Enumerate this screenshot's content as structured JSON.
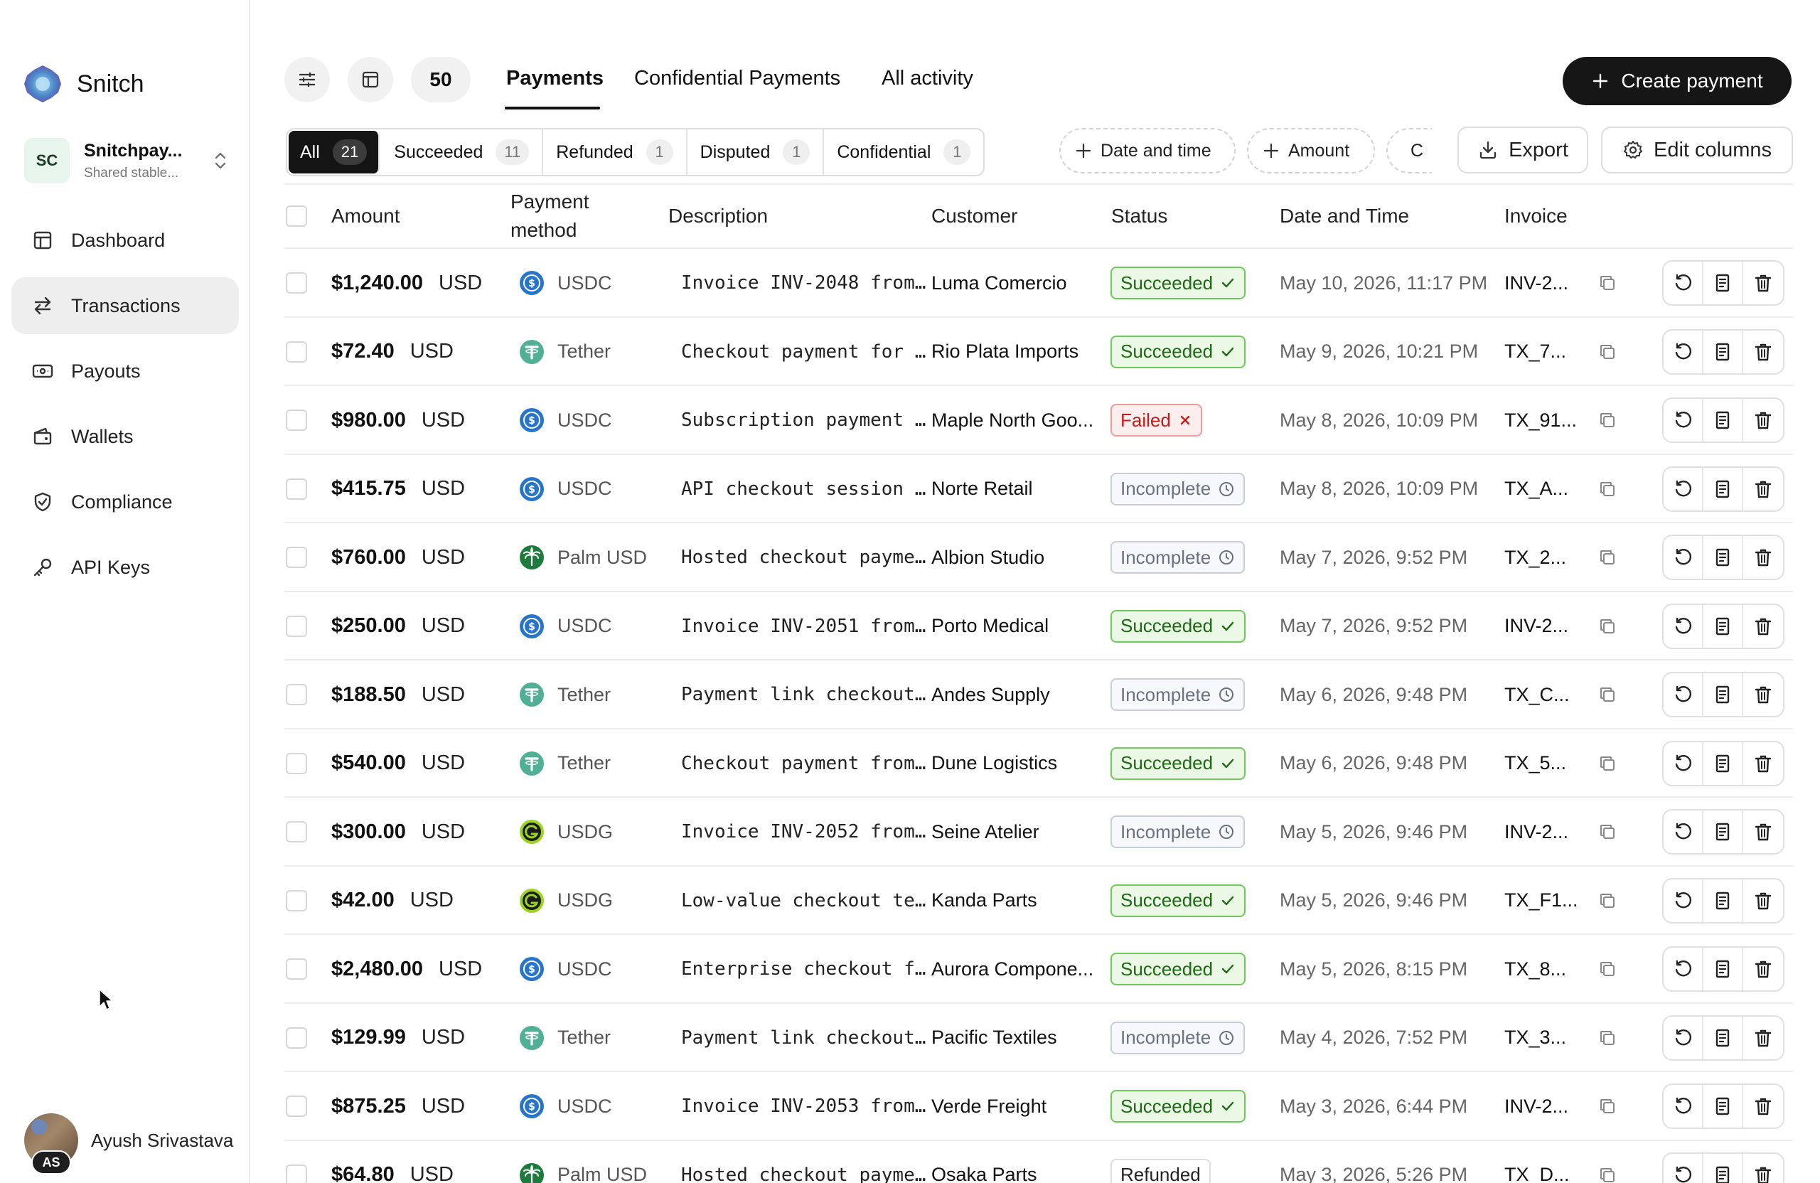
{
  "brand": {
    "name": "Snitch"
  },
  "org": {
    "initials": "SC",
    "name": "Snitchpay...",
    "subtitle": "Shared stable..."
  },
  "nav": [
    {
      "label": "Dashboard",
      "icon": "dashboard-icon",
      "active": false
    },
    {
      "label": "Transactions",
      "icon": "arrows-exchange-icon",
      "active": true
    },
    {
      "label": "Payouts",
      "icon": "banknote-icon",
      "active": false
    },
    {
      "label": "Wallets",
      "icon": "wallet-icon",
      "active": false
    },
    {
      "label": "Compliance",
      "icon": "shield-check-icon",
      "active": false
    },
    {
      "label": "API Keys",
      "icon": "key-icon",
      "active": false
    }
  ],
  "user": {
    "name": "Ayush Srivastava",
    "initials": "AS"
  },
  "toolbar": {
    "page_size": "50",
    "tabs": [
      "Payments",
      "Confidential Payments",
      "All activity"
    ],
    "active_tab": "Payments",
    "create_label": "Create payment"
  },
  "filters": {
    "segments": [
      {
        "label": "All",
        "count": "21",
        "active": true
      },
      {
        "label": "Succeeded",
        "count": "11",
        "active": false
      },
      {
        "label": "Refunded",
        "count": "1",
        "active": false
      },
      {
        "label": "Disputed",
        "count": "1",
        "active": false
      },
      {
        "label": "Confidential",
        "count": "1",
        "active": false
      }
    ],
    "add_chips": [
      "Date and time",
      "Amount",
      "C"
    ],
    "export_label": "Export",
    "edit_columns_label": "Edit columns"
  },
  "table": {
    "headers": {
      "amount": "Amount",
      "payment_method": "Payment method",
      "description": "Description",
      "customer": "Customer",
      "status": "Status",
      "date": "Date and Time",
      "invoice": "Invoice"
    },
    "rows": [
      {
        "amount": "$1,240.00",
        "currency": "USD",
        "method": "USDC",
        "description": "Invoice INV-2048 from…",
        "customer": "Luma Comercio",
        "status": "Succeeded",
        "date": "May 10, 2026, 11:17 PM",
        "invoice": "INV-2..."
      },
      {
        "amount": "$72.40",
        "currency": "USD",
        "method": "Tether",
        "description": "Checkout payment for …",
        "customer": "Rio Plata Imports",
        "status": "Succeeded",
        "date": "May 9, 2026, 10:21 PM",
        "invoice": "TX_7..."
      },
      {
        "amount": "$980.00",
        "currency": "USD",
        "method": "USDC",
        "description": "Subscription payment …",
        "customer": "Maple North Goo...",
        "status": "Failed",
        "date": "May 8, 2026, 10:09 PM",
        "invoice": "TX_91..."
      },
      {
        "amount": "$415.75",
        "currency": "USD",
        "method": "USDC",
        "description": "API checkout session …",
        "customer": "Norte Retail",
        "status": "Incomplete",
        "date": "May 8, 2026, 10:09 PM",
        "invoice": "TX_A..."
      },
      {
        "amount": "$760.00",
        "currency": "USD",
        "method": "Palm USD",
        "description": "Hosted checkout payme…",
        "customer": "Albion Studio",
        "status": "Incomplete",
        "date": "May 7, 2026, 9:52 PM",
        "invoice": "TX_2..."
      },
      {
        "amount": "$250.00",
        "currency": "USD",
        "method": "USDC",
        "description": "Invoice INV-2051 from…",
        "customer": "Porto Medical",
        "status": "Succeeded",
        "date": "May 7, 2026, 9:52 PM",
        "invoice": "INV-2..."
      },
      {
        "amount": "$188.50",
        "currency": "USD",
        "method": "Tether",
        "description": "Payment link checkout…",
        "customer": "Andes Supply",
        "status": "Incomplete",
        "date": "May 6, 2026, 9:48 PM",
        "invoice": "TX_C..."
      },
      {
        "amount": "$540.00",
        "currency": "USD",
        "method": "Tether",
        "description": "Checkout payment from…",
        "customer": "Dune Logistics",
        "status": "Succeeded",
        "date": "May 6, 2026, 9:48 PM",
        "invoice": "TX_5..."
      },
      {
        "amount": "$300.00",
        "currency": "USD",
        "method": "USDG",
        "description": "Invoice INV-2052 from…",
        "customer": "Seine Atelier",
        "status": "Incomplete",
        "date": "May 5, 2026, 9:46 PM",
        "invoice": "INV-2..."
      },
      {
        "amount": "$42.00",
        "currency": "USD",
        "method": "USDG",
        "description": "Low-value checkout te…",
        "customer": "Kanda Parts",
        "status": "Succeeded",
        "date": "May 5, 2026, 9:46 PM",
        "invoice": "TX_F1..."
      },
      {
        "amount": "$2,480.00",
        "currency": "USD",
        "method": "USDC",
        "description": "Enterprise checkout f…",
        "customer": "Aurora Compone...",
        "status": "Succeeded",
        "date": "May 5, 2026, 8:15 PM",
        "invoice": "TX_8..."
      },
      {
        "amount": "$129.99",
        "currency": "USD",
        "method": "Tether",
        "description": "Payment link checkout…",
        "customer": "Pacific Textiles",
        "status": "Incomplete",
        "date": "May 4, 2026, 7:52 PM",
        "invoice": "TX_3..."
      },
      {
        "amount": "$875.25",
        "currency": "USD",
        "method": "USDC",
        "description": "Invoice INV-2053 from…",
        "customer": "Verde Freight",
        "status": "Succeeded",
        "date": "May 3, 2026, 6:44 PM",
        "invoice": "INV-2..."
      },
      {
        "amount": "$64.80",
        "currency": "USD",
        "method": "Palm USD",
        "description": "Hosted checkout payme…",
        "customer": "Osaka Parts",
        "status": "Refunded",
        "date": "May 3, 2026, 5:26 PM",
        "invoice": "TX_D..."
      }
    ]
  },
  "colors": {
    "accent_dark": "#161616",
    "succeeded": "#6fc85a",
    "failed": "#e05555",
    "incomplete": "#8a93a0",
    "usdc": "#2775ca",
    "tether": "#50af95",
    "palm": "#1f7a3e",
    "usdg": "#9bd31e"
  }
}
